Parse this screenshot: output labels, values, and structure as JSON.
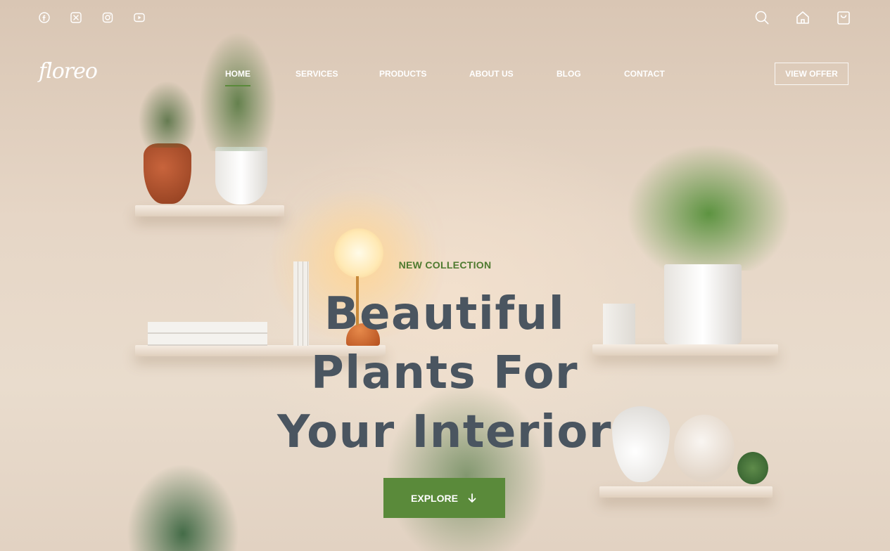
{
  "social": [
    {
      "name": "facebook-icon"
    },
    {
      "name": "x-icon"
    },
    {
      "name": "instagram-icon"
    },
    {
      "name": "youtube-icon"
    }
  ],
  "utility": [
    {
      "name": "search-icon"
    },
    {
      "name": "home-icon"
    },
    {
      "name": "shopping-bag-icon"
    }
  ],
  "brand": {
    "logo_text": "floreo"
  },
  "nav": {
    "items": [
      {
        "label": "HOME",
        "active": true
      },
      {
        "label": "SERVICES"
      },
      {
        "label": "PRODUCTS"
      },
      {
        "label": "ABOUT US"
      },
      {
        "label": "BLOG"
      },
      {
        "label": "CONTACT"
      }
    ],
    "offer_button": "VIEW OFFER"
  },
  "hero": {
    "eyebrow": "NEW COLLECTION",
    "headline_lines": [
      "Beautiful",
      "Plants For",
      "Your Interior"
    ],
    "button_label": "EXPLORE",
    "button_icon": "arrow-down-icon"
  },
  "colors": {
    "accent": "#5a8a3a",
    "eyebrow": "#4e7a2f",
    "headline": "#4a5560",
    "nav_text": "#ffffff"
  }
}
